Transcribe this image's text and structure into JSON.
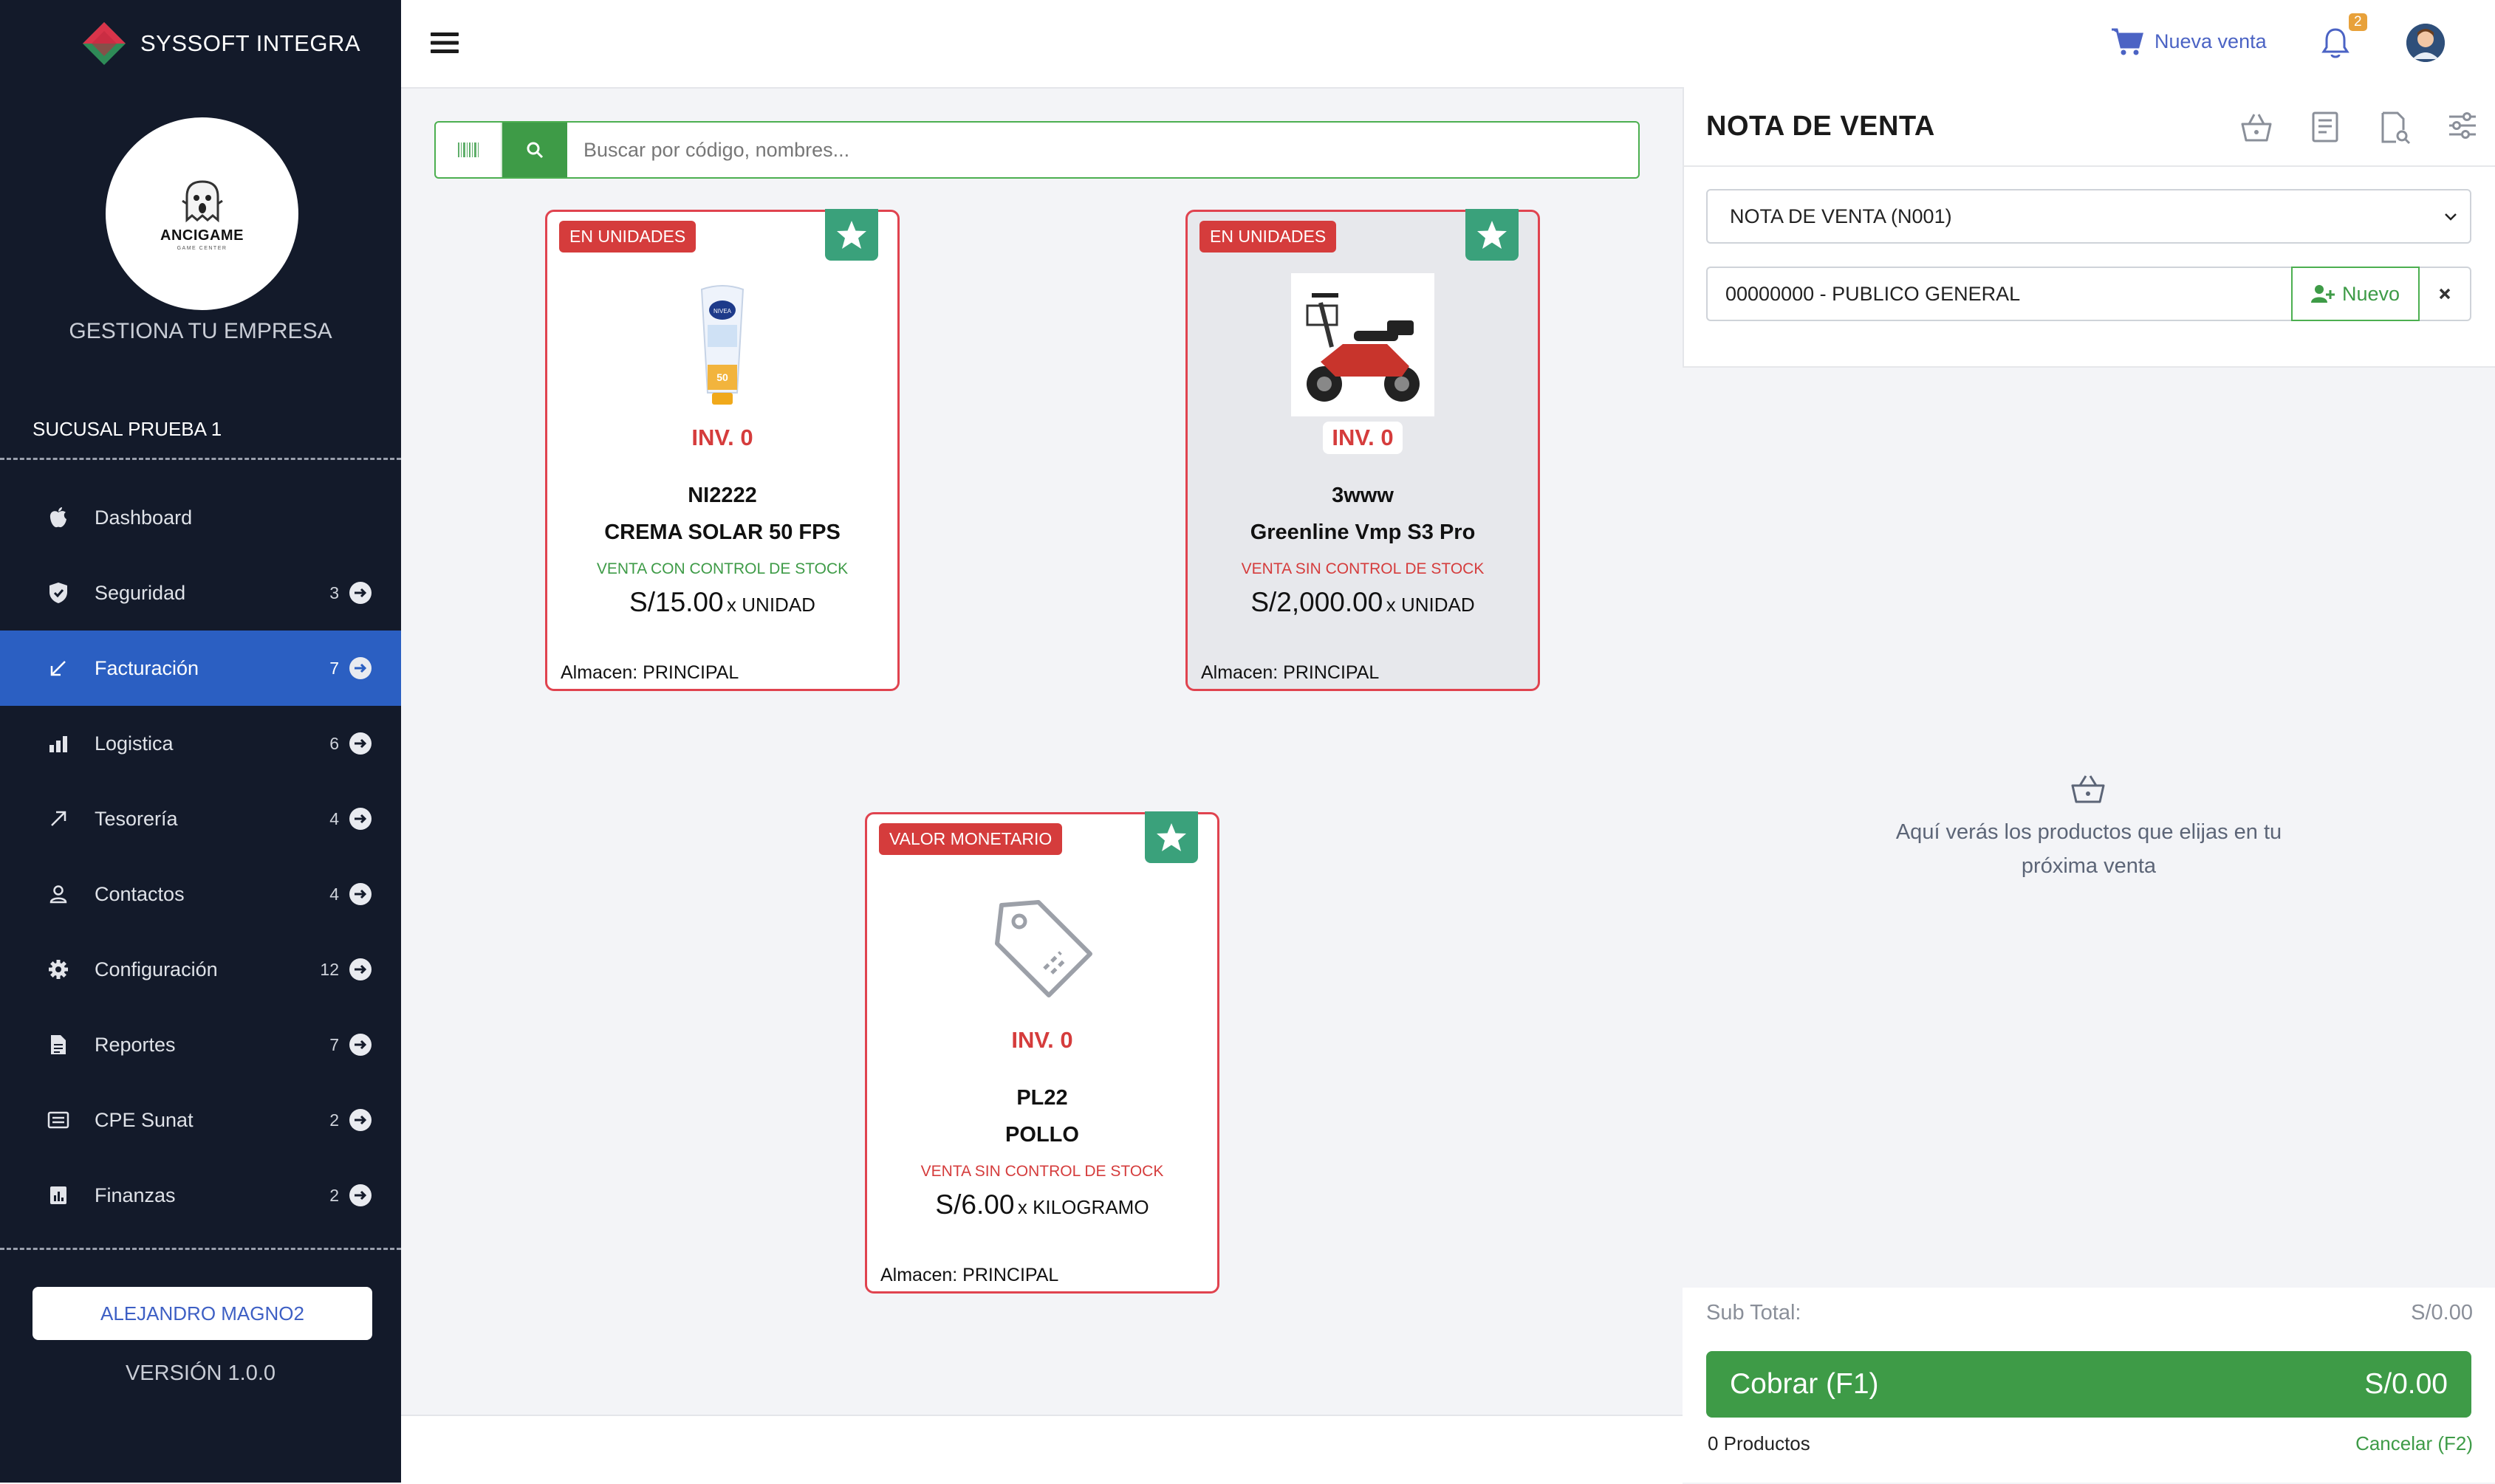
{
  "brand": {
    "name": "SYSSOFT INTEGRA"
  },
  "company_logo": {
    "title": "ANCIGAME",
    "subtitle": "GAME CENTER"
  },
  "sidebar": {
    "tagline": "GESTIONA TU EMPRESA",
    "branch": "SUCUSAL PRUEBA 1",
    "items": [
      {
        "label": "Dashboard",
        "icon": "apple-icon"
      },
      {
        "label": "Seguridad",
        "count": "3",
        "icon": "shield-icon"
      },
      {
        "label": "Facturación",
        "count": "7",
        "icon": "arrow-down-left-icon",
        "active": true
      },
      {
        "label": "Logistica",
        "count": "6",
        "icon": "bar-chart-icon"
      },
      {
        "label": "Tesorería",
        "count": "4",
        "icon": "arrow-up-right-icon"
      },
      {
        "label": "Contactos",
        "count": "4",
        "icon": "user-icon"
      },
      {
        "label": "Configuración",
        "count": "12",
        "icon": "gear-icon"
      },
      {
        "label": "Reportes",
        "count": "7",
        "icon": "document-icon"
      },
      {
        "label": "CPE Sunat",
        "count": "2",
        "icon": "receipt-icon"
      },
      {
        "label": "Finanzas",
        "count": "2",
        "icon": "chart-icon"
      }
    ],
    "user": "ALEJANDRO MAGNO2",
    "version": "VERSIÓN 1.0.0"
  },
  "topbar": {
    "new_sale": "Nueva venta",
    "notifications": "2"
  },
  "search": {
    "placeholder": "Buscar por código, nombres..."
  },
  "products": [
    {
      "badge": "EN UNIDADES",
      "inventory": "INV. 0",
      "code": "NI2222",
      "name": "CREMA SOLAR 50 FPS",
      "stock_mode": "VENTA CON CONTROL DE STOCK",
      "stock_color": "#3e9b47",
      "price": "S/15.00",
      "unit": "x UNIDAD",
      "warehouse": "Almacen: PRINCIPAL"
    },
    {
      "badge": "EN UNIDADES",
      "inventory": "INV. 0",
      "code": "3www",
      "name": "Greenline Vmp S3 Pro",
      "stock_mode": "VENTA SIN CONTROL DE STOCK",
      "stock_color": "#d53c3c",
      "price": "S/2,000.00",
      "unit": "x UNIDAD",
      "warehouse": "Almacen: PRINCIPAL"
    },
    {
      "badge": "VALOR MONETARIO",
      "inventory": "INV. 0",
      "code": "PL22",
      "name": "POLLO",
      "stock_mode": "VENTA SIN CONTROL DE STOCK",
      "stock_color": "#d53c3c",
      "price": "S/6.00",
      "unit": "x KILOGRAMO",
      "warehouse": "Almacen: PRINCIPAL"
    }
  ],
  "panel": {
    "title": "NOTA DE VENTA",
    "document_type": "NOTA DE VENTA (N001)",
    "client": "00000000 - PUBLICO GENERAL",
    "new_client": "Nuevo",
    "empty_message": "Aquí verás los productos que elijas en tu próxima venta",
    "subtotal_label": "Sub Total:",
    "subtotal_value": "S/0.00",
    "charge_label": "Cobrar (F1)",
    "charge_value": "S/0.00",
    "product_count": "0 Productos",
    "cancel": "Cancelar (F2)"
  }
}
